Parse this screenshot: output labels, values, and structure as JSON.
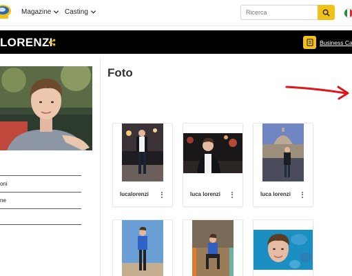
{
  "nav": {
    "items": [
      {
        "label": "Magazine"
      },
      {
        "label": "Casting"
      }
    ],
    "search": {
      "placeholder": "Ricerca",
      "value": ""
    }
  },
  "banner": {
    "name": "LORENZI",
    "business_card_label": "Business Card"
  },
  "profile": {
    "rows": [
      "",
      "oni",
      "ne",
      ""
    ]
  },
  "photos": {
    "title": "Foto",
    "items": [
      {
        "caption": "lucalorenzi"
      },
      {
        "caption": "luca lorenzi"
      },
      {
        "caption": "luca lorenzi"
      },
      {
        "caption": ""
      },
      {
        "caption": ""
      },
      {
        "caption": ""
      }
    ]
  },
  "colors": {
    "accent": "#f2c01a",
    "banner_bg": "#000000",
    "annotation": "#e0141b"
  },
  "icons": [
    "logo-icon",
    "chevron-down-icon",
    "search-icon",
    "italy-flag-icon",
    "share-icon",
    "business-card-icon",
    "more-vertical-icon"
  ]
}
